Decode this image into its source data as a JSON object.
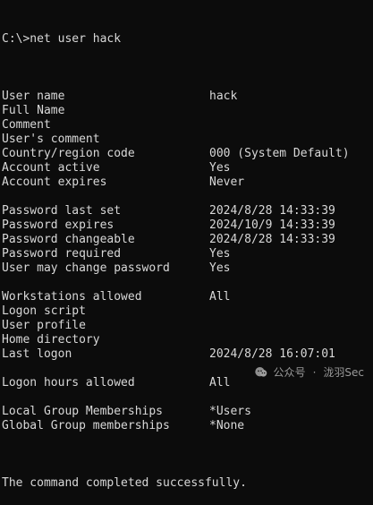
{
  "terminal": {
    "prompt": "C:\\>net user hack",
    "rows": [
      {
        "key": "User name",
        "value": "hack"
      },
      {
        "key": "Full Name",
        "value": ""
      },
      {
        "key": "Comment",
        "value": ""
      },
      {
        "key": "User's comment",
        "value": ""
      },
      {
        "key": "Country/region code",
        "value": "000 (System Default)"
      },
      {
        "key": "Account active",
        "value": "Yes"
      },
      {
        "key": "Account expires",
        "value": "Never"
      },
      {
        "key": "",
        "value": ""
      },
      {
        "key": "Password last set",
        "value": "2024/8/28 14:33:39"
      },
      {
        "key": "Password expires",
        "value": "2024/10/9 14:33:39"
      },
      {
        "key": "Password changeable",
        "value": "2024/8/28 14:33:39"
      },
      {
        "key": "Password required",
        "value": "Yes"
      },
      {
        "key": "User may change password",
        "value": "Yes"
      },
      {
        "key": "",
        "value": ""
      },
      {
        "key": "Workstations allowed",
        "value": "All"
      },
      {
        "key": "Logon script",
        "value": ""
      },
      {
        "key": "User profile",
        "value": ""
      },
      {
        "key": "Home directory",
        "value": ""
      },
      {
        "key": "Last logon",
        "value": "2024/8/28 16:07:01"
      },
      {
        "key": "",
        "value": ""
      },
      {
        "key": "Logon hours allowed",
        "value": "All"
      },
      {
        "key": "",
        "value": ""
      },
      {
        "key": "Local Group Memberships",
        "value": "*Users"
      },
      {
        "key": "Global Group memberships",
        "value": "*None"
      }
    ],
    "footer": "The command completed successfully."
  },
  "watermark": {
    "icon": "wechat-official-account-icon",
    "left": "公众号",
    "separator": "·",
    "right": "泷羽Sec"
  }
}
